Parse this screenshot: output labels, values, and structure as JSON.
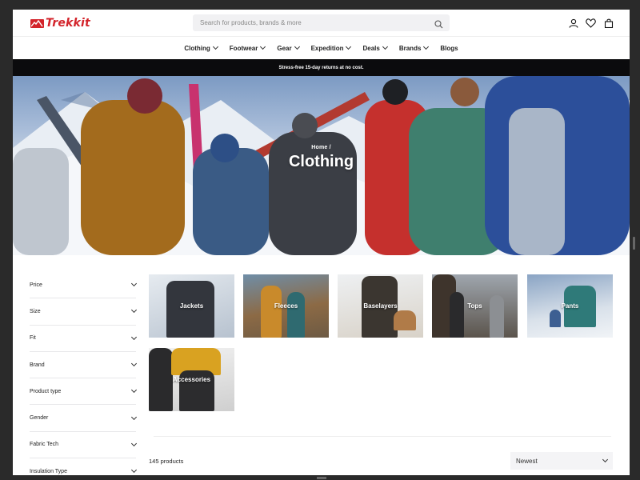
{
  "brand": {
    "name": "Trekkit",
    "color": "#d3232a"
  },
  "search": {
    "placeholder": "Search for products, brands & more",
    "icon": "search-icon"
  },
  "header_icons": [
    "user-icon",
    "heart-icon",
    "bag-icon"
  ],
  "nav": {
    "items": [
      {
        "label": "Clothing",
        "has_dropdown": true
      },
      {
        "label": "Footwear",
        "has_dropdown": true
      },
      {
        "label": "Gear",
        "has_dropdown": true
      },
      {
        "label": "Expedition",
        "has_dropdown": true
      },
      {
        "label": "Deals",
        "has_dropdown": true
      },
      {
        "label": "Brands",
        "has_dropdown": true
      },
      {
        "label": "Blogs",
        "has_dropdown": false
      }
    ]
  },
  "promo": {
    "text": "Stress-free 15-day returns at no cost."
  },
  "hero": {
    "breadcrumb": "Home /",
    "title": "Clothing"
  },
  "filters": {
    "items": [
      "Price",
      "Size",
      "Fit",
      "Brand",
      "Product type",
      "Gender",
      "Fabric Tech",
      "Insulation Type"
    ]
  },
  "categories": [
    {
      "label": "Jackets"
    },
    {
      "label": "Fleeces"
    },
    {
      "label": "Baselayers"
    },
    {
      "label": "Tops"
    },
    {
      "label": "Pants"
    },
    {
      "label": "Accessories"
    }
  ],
  "results": {
    "count": "145 products"
  },
  "sort": {
    "selected": "Newest"
  }
}
